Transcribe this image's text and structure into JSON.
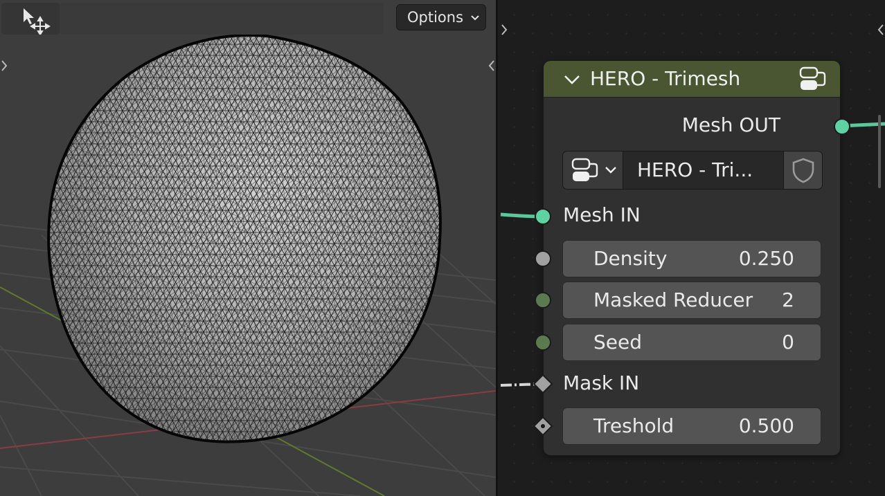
{
  "viewport": {
    "options_label": "Options",
    "tool_icon": "move-cursor-icon",
    "object_icon": "wireframe-sphere-icon"
  },
  "node": {
    "title": "HERO - Trimesh",
    "header_icon": "node-group-icon",
    "output": "Mesh OUT",
    "nodegroup_name": "HERO - Tri...",
    "nodegroup_icon": "node-group-icon",
    "fake_user_icon": "shield-icon",
    "inputs": {
      "mesh_in": "Mesh IN",
      "mask_in": "Mask IN"
    },
    "fields": [
      {
        "label": "Density",
        "value": "0.250"
      },
      {
        "label": "Masked Reducer",
        "value": "2"
      },
      {
        "label": "Seed",
        "value": "0"
      },
      {
        "label": "Treshold",
        "value": "0.500"
      }
    ]
  },
  "colors": {
    "header_green": "#4a5532",
    "geometry_socket": "#00d6a3",
    "wire_green": "#5cc79a",
    "float_socket": "#a1a1a1",
    "int_socket": "#5c7a52"
  }
}
